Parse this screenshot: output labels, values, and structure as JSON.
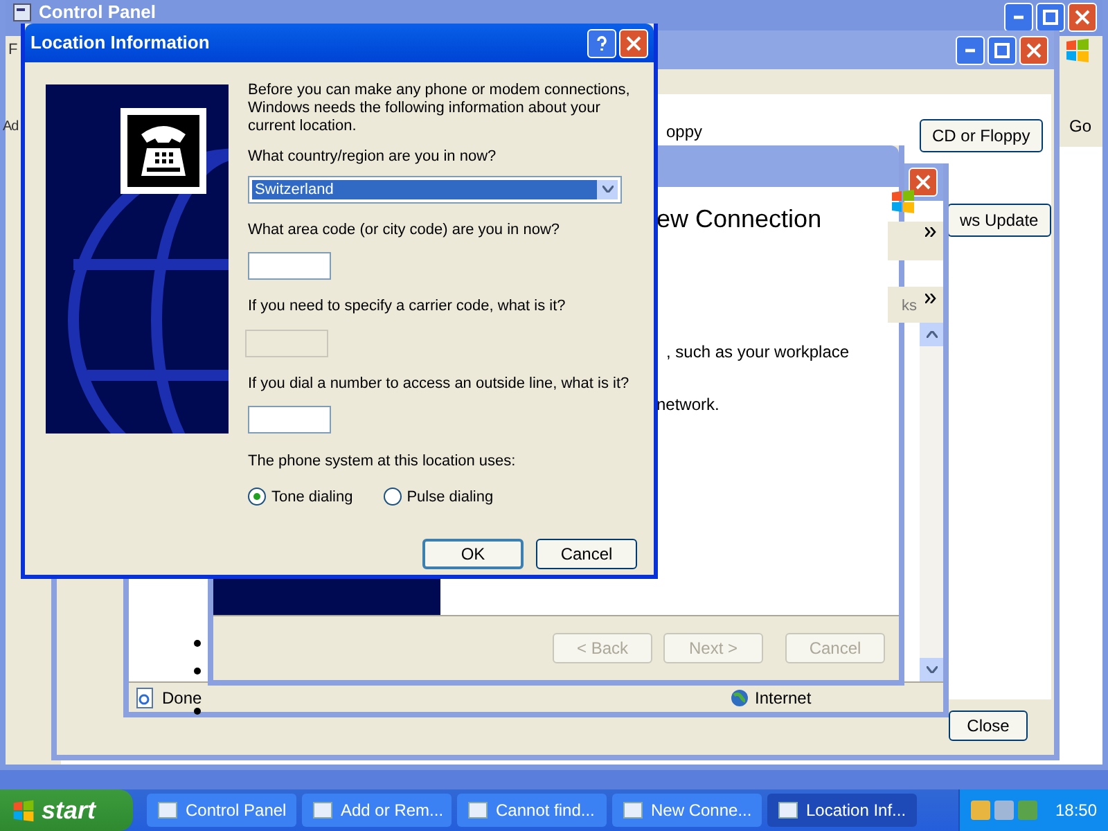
{
  "control_panel_window": {
    "title": "Control Panel",
    "menu_fragment": "F",
    "address_fragment": "Ad",
    "go_button": "Go"
  },
  "add_remove_window": {
    "text_fragment": "oppy",
    "buttons": [
      {
        "label": "CD or Floppy"
      },
      {
        "label": "ws Update"
      }
    ],
    "close_button": "Close"
  },
  "browser_window": {
    "links_fragment": "ks",
    "status_text": "Done",
    "zone": "Internet"
  },
  "wizard_window": {
    "heading": "ew Connection",
    "texts": [
      ", such as your workplace",
      "network."
    ],
    "buttons": [
      {
        "label": "< Back",
        "disabled": true
      },
      {
        "label": "Next >",
        "disabled": true
      },
      {
        "label": "Cancel",
        "disabled": true
      }
    ]
  },
  "dialog": {
    "title": "Location Information",
    "intro": "Before you can make any phone or modem connections, Windows needs the following information about your current location.",
    "country_label": "What country/region are you in now?",
    "country_value": "Switzerland",
    "fields": [
      {
        "label": "What area code (or city code) are you in now?",
        "disabled": false
      },
      {
        "label": "If you need to specify a carrier code, what is it?",
        "disabled": true
      },
      {
        "label": "If you dial a number to access an outside line, what is it?",
        "disabled": false
      }
    ],
    "phone_system_label": "The phone system at this location uses:",
    "dialing": [
      {
        "label": "Tone dialing",
        "selected": true
      },
      {
        "label": "Pulse dialing",
        "selected": false
      }
    ],
    "buttons": [
      {
        "label": "OK",
        "default": true
      },
      {
        "label": "Cancel",
        "default": false
      }
    ]
  },
  "taskbar": {
    "start": "start",
    "items": [
      {
        "label": "Control Panel",
        "selected": false
      },
      {
        "label": "Add or Rem...",
        "selected": false
      },
      {
        "label": "Cannot find...",
        "selected": false
      },
      {
        "label": "New Conne...",
        "selected": false
      },
      {
        "label": "Location Inf...",
        "selected": true
      }
    ],
    "clock": "18:50"
  }
}
